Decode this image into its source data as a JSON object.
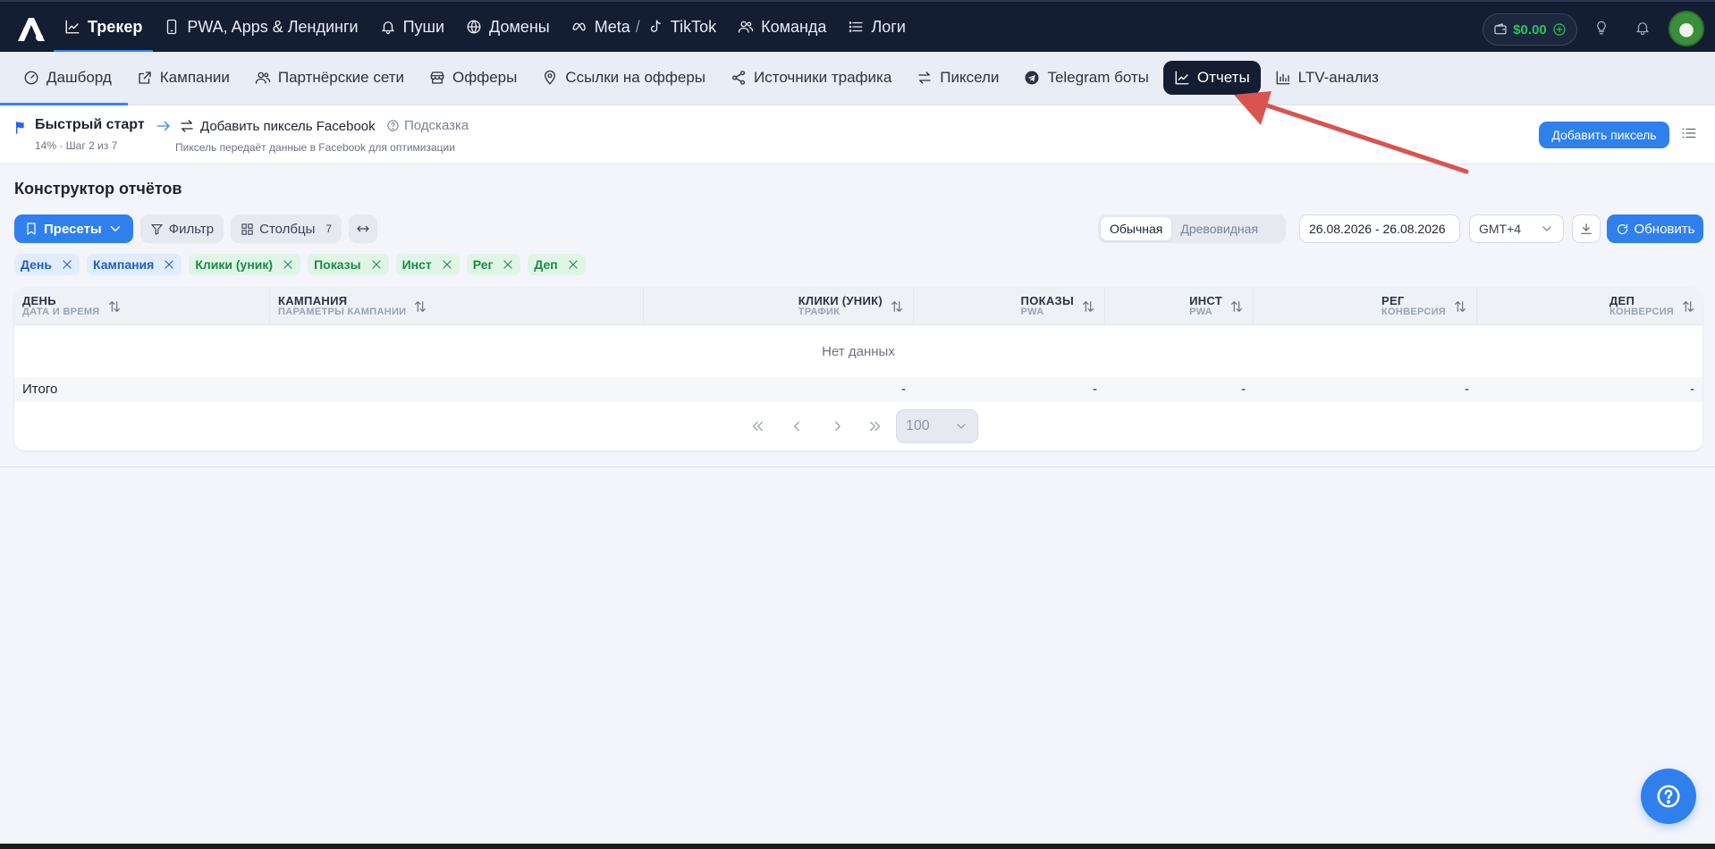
{
  "topnav": {
    "items": [
      {
        "label": "Трекер",
        "icon": "chart-line-icon",
        "active": true
      },
      {
        "label": "PWA, Apps & Лендинги",
        "icon": "smartphone-icon"
      },
      {
        "label": "Пуши",
        "icon": "bell-icon"
      },
      {
        "label": "Домены",
        "icon": "globe-icon"
      },
      {
        "label": "Meta",
        "icon": "meta-icon"
      },
      {
        "label": "TikTok",
        "icon": "tiktok-icon"
      },
      {
        "label": "Команда",
        "icon": "users-icon"
      },
      {
        "label": "Логи",
        "icon": "list-icon"
      }
    ],
    "separator": "/",
    "wallet_balance": "$0.00"
  },
  "subnav": {
    "items": [
      {
        "label": "Дашборд",
        "icon": "gauge-icon"
      },
      {
        "label": "Кампании",
        "icon": "external-link-icon"
      },
      {
        "label": "Партнёрские сети",
        "icon": "users-icon"
      },
      {
        "label": "Офферы",
        "icon": "store-icon"
      },
      {
        "label": "Ссылки на офферы",
        "icon": "map-pin-icon"
      },
      {
        "label": "Источники трафика",
        "icon": "share-icon"
      },
      {
        "label": "Пиксели",
        "icon": "arrows-swap-icon"
      },
      {
        "label": "Telegram боты",
        "icon": "telegram-icon"
      },
      {
        "label": "Отчеты",
        "icon": "chart-line-icon",
        "active": true
      },
      {
        "label": "LTV-анализ",
        "icon": "bar-chart-icon"
      }
    ]
  },
  "quickstart": {
    "title": "Быстрый старт",
    "progress": "14% · Шаг 2 из 7",
    "step_label": "Добавить пиксель Facebook",
    "hint_label": "Подсказка",
    "step_description": "Пиксель передаёт данные в Facebook для оптимизации",
    "add_pixel_button": "Добавить пиксель"
  },
  "report": {
    "title": "Конструктор отчётов",
    "presets_button": "Пресеты",
    "filter_button": "Фильтр",
    "columns_button": "Столбцы",
    "columns_count": "7",
    "view_modes": [
      "Обычная",
      "Древовидная"
    ],
    "active_view": "Обычная",
    "date_range": "26.08.2026 - 26.08.2026",
    "timezone": "GMT+4",
    "refresh_button": "Обновить",
    "chips": [
      {
        "label": "День",
        "color": "blue"
      },
      {
        "label": "Кампания",
        "color": "blue"
      },
      {
        "label": "Клики (уник)",
        "color": "green"
      },
      {
        "label": "Показы",
        "color": "green"
      },
      {
        "label": "Инст",
        "color": "green"
      },
      {
        "label": "Рег",
        "color": "green"
      },
      {
        "label": "Деп",
        "color": "green"
      }
    ],
    "columns": [
      {
        "title": "ДЕНЬ",
        "subtitle": "ДАТА И ВРЕМЯ"
      },
      {
        "title": "КАМПАНИЯ",
        "subtitle": "ПАРАМЕТРЫ КАМПАНИИ"
      },
      {
        "title": "КЛИКИ (УНИК)",
        "subtitle": "ТРАФИК"
      },
      {
        "title": "ПОКАЗЫ",
        "subtitle": "PWA"
      },
      {
        "title": "ИНСТ",
        "subtitle": "PWA"
      },
      {
        "title": "РЕГ",
        "subtitle": "КОНВЕРСИЯ"
      },
      {
        "title": "ДЕП",
        "subtitle": "КОНВЕРСИЯ"
      }
    ],
    "empty_text": "Нет данных",
    "totals_label": "Итого",
    "totals_values": [
      "-",
      "-",
      "-",
      "-",
      "-"
    ],
    "page_size": "100"
  },
  "colors": {
    "accent": "#2f80ed",
    "nav_bg": "#141e33",
    "annotation_arrow": "#d9534f"
  }
}
